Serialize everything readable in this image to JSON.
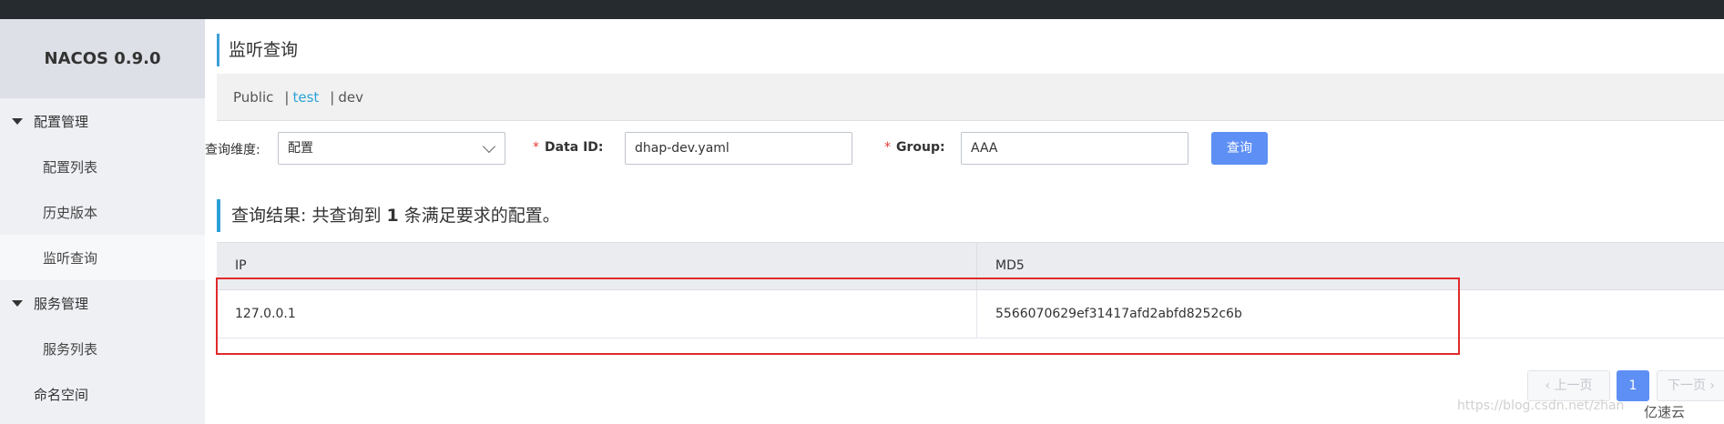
{
  "app": {
    "title": "NACOS 0.9.0"
  },
  "sidebar": {
    "groups": [
      {
        "label": "配置管理",
        "items": [
          "配置列表",
          "历史版本",
          "监听查询"
        ]
      },
      {
        "label": "服务管理",
        "items": [
          "服务列表"
        ]
      }
    ],
    "namespace_label": "命名空间",
    "active_item": "监听查询"
  },
  "page": {
    "title": "监听查询"
  },
  "namespaces": {
    "items": [
      "Public",
      "test",
      "dev"
    ],
    "separator": "|",
    "active": "test"
  },
  "form": {
    "dimension_label": "查询维度:",
    "dimension_value": "配置",
    "required_mark": "*",
    "dataid_label": "Data ID:",
    "dataid_value": "dhap-dev.yaml",
    "group_label": "Group:",
    "group_value": "AAA",
    "query_button": "查询"
  },
  "result": {
    "prefix": "查询结果: 共查询到",
    "count": "1",
    "suffix": "条满足要求的配置。"
  },
  "table": {
    "columns": [
      "IP",
      "MD5"
    ],
    "rows": [
      {
        "ip": "127.0.0.1",
        "md5": "5566070629ef31417afd2abfd8252c6b"
      }
    ]
  },
  "pagination": {
    "prev": "上一页",
    "page": "1",
    "next": "下一页"
  },
  "watermark": "https://blog.csdn.net/zhan",
  "logo_text": "亿速云",
  "colors": {
    "accent": "#5e8ff5",
    "highlight_box": "#e02a2a",
    "active_namespace": "#2aa4d8"
  }
}
